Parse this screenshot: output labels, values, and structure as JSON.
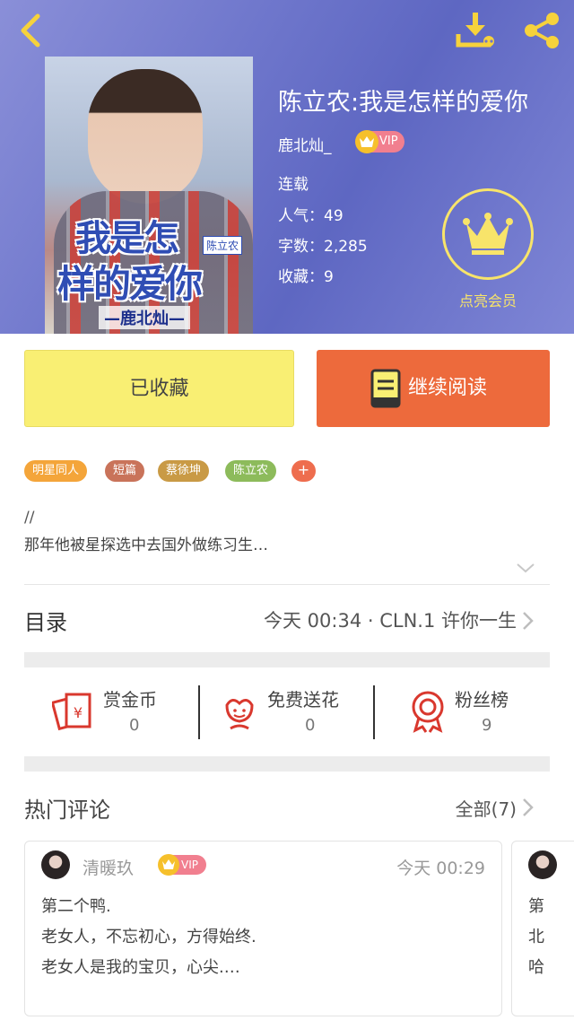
{
  "header": {
    "back_icon": "chevron-left-icon",
    "download_icon": "download-icon",
    "share_icon": "share-icon"
  },
  "book": {
    "cover_title_line1": "我是怎",
    "cover_title_line2": "样的爱你",
    "cover_tag": "陈立农",
    "cover_author": "—鹿北灿—",
    "title": "陈立农:我是怎样的爱你",
    "author": "鹿北灿_",
    "vip_label": "VIP",
    "status": "连载",
    "popularity": "人气：49",
    "word_count": "字数：2,285",
    "favorites": "收藏：9"
  },
  "member": {
    "label": "点亮会员",
    "icon": "crown-icon"
  },
  "actions": {
    "favorite_label": "已收藏",
    "read_label": "继续阅读"
  },
  "tags": [
    {
      "label": "明星同人",
      "color": "#f4a53a"
    },
    {
      "label": "短篇",
      "color": "#c9735a"
    },
    {
      "label": "蔡徐坤",
      "color": "#c99a45"
    },
    {
      "label": "陈立农",
      "color": "#8dbb5b"
    }
  ],
  "tag_add_label": "+",
  "description": {
    "line1": "//",
    "line2": "那年他被星探选中去国外做练习生…"
  },
  "toc": {
    "label": "目录",
    "latest": "今天 00:34 · CLN.1 许你一生"
  },
  "stats": [
    {
      "label": "赏金币",
      "value": "0",
      "icon": "red-envelope-icon"
    },
    {
      "label": "免费送花",
      "value": "0",
      "icon": "flower-icon"
    },
    {
      "label": "粉丝榜",
      "value": "9",
      "icon": "medal-icon"
    }
  ],
  "comments": {
    "title": "热门评论",
    "all_label": "全部(7)",
    "items": [
      {
        "user": "清暖玖",
        "vip_label": "VIP",
        "time": "今天 00:29",
        "lines": [
          "第二个鸭.",
          "老女人，不忘初心，方得始终.",
          "老女人是我的宝贝，心尖.…"
        ]
      },
      {
        "lines": [
          "第",
          "北",
          "哈"
        ]
      }
    ]
  },
  "colors": {
    "hero_gradient": "#6f77cc",
    "accent_yellow": "#f9ef73",
    "accent_orange": "#ed6a3c",
    "vip_pink": "#f17f8f",
    "crown_gold": "#f6c02b"
  }
}
